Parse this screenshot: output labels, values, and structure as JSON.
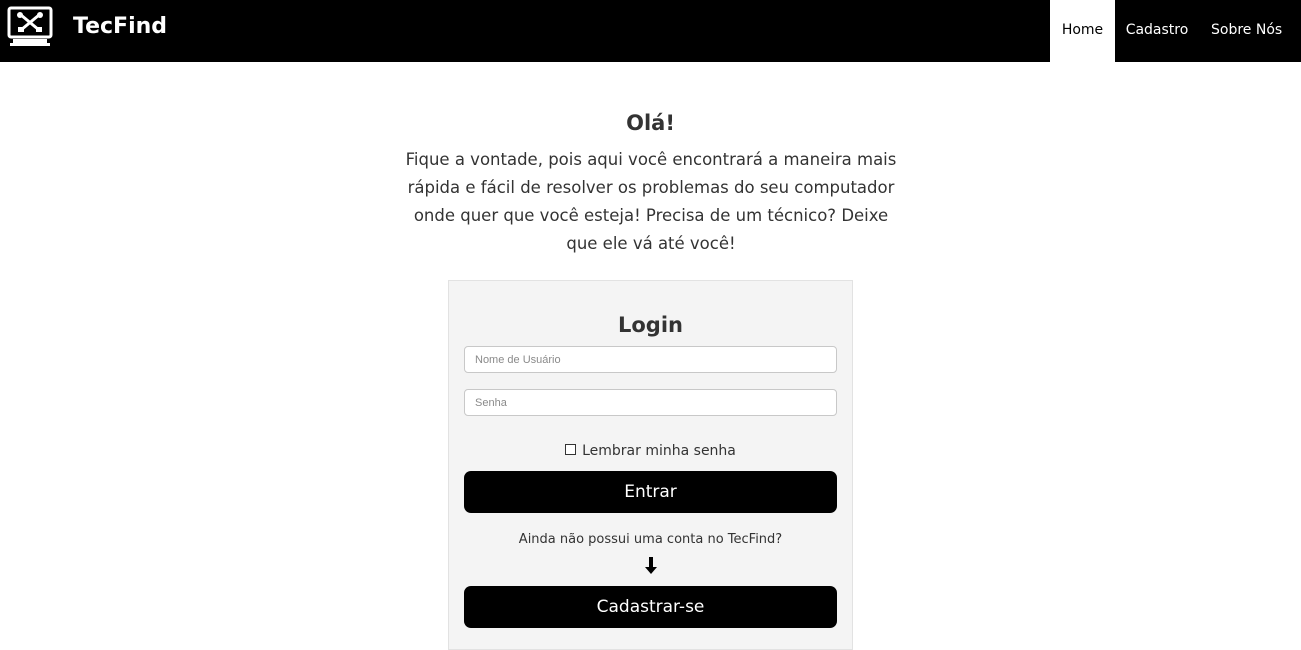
{
  "navbar": {
    "brand_name": "TecFind",
    "logo_icon": "monitor-tools-icon",
    "links": [
      {
        "label": "Home",
        "active": true
      },
      {
        "label": "Cadastro",
        "active": false
      },
      {
        "label": "Sobre Nós",
        "active": false
      }
    ]
  },
  "intro": {
    "title": "Olá!",
    "text": "Fique a vontade, pois aqui você encontrará a maneira mais rápida e fácil de resolver os problemas do seu computador onde quer que você esteja! Precisa de um técnico? Deixe que ele vá até você!"
  },
  "login": {
    "title": "Login",
    "username_placeholder": "Nome de Usuário",
    "password_placeholder": "Senha",
    "username_value": "",
    "password_value": "",
    "remember_label": "Lembrar minha senha",
    "remember_checked": false,
    "enter_label": "Entrar",
    "no_account_text": "Ainda não possui uma conta no TecFind?",
    "arrow_icon": "arrow-down-icon",
    "signup_label": "Cadastrar-se"
  },
  "colors": {
    "navbar_bg": "#000000",
    "panel_bg": "#f4f4f4",
    "button_bg": "#000000",
    "text": "#333333"
  }
}
